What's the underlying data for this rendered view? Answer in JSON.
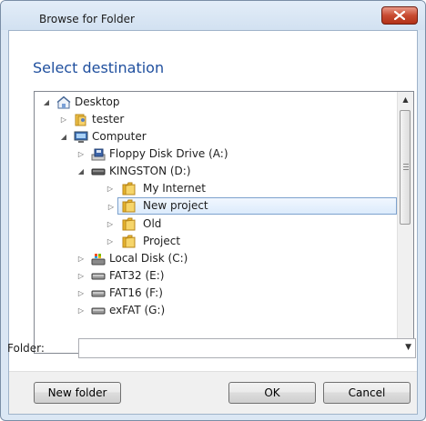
{
  "window": {
    "title": "Browse for Folder"
  },
  "heading": "Select destination",
  "tree": {
    "items": [
      {
        "label": "Desktop",
        "icon": "desktop-icon",
        "expander": "expanded"
      },
      {
        "label": "tester",
        "icon": "user-folder-icon",
        "expander": "collapsed"
      },
      {
        "label": "Computer",
        "icon": "computer-icon",
        "expander": "expanded"
      },
      {
        "label": "Floppy Disk Drive (A:)",
        "icon": "floppy-drive-icon",
        "expander": "collapsed"
      },
      {
        "label": "KINGSTON (D:)",
        "icon": "removable-drive-icon",
        "expander": "expanded"
      },
      {
        "label": "My Internet",
        "icon": "folder-icon",
        "expander": "collapsed"
      },
      {
        "label": "New project",
        "icon": "folder-icon",
        "expander": "collapsed",
        "selected": true
      },
      {
        "label": "Old",
        "icon": "folder-icon",
        "expander": "collapsed"
      },
      {
        "label": "Project",
        "icon": "folder-icon",
        "expander": "collapsed"
      },
      {
        "label": "Local Disk (C:)",
        "icon": "local-disk-icon",
        "expander": "collapsed"
      },
      {
        "label": "FAT32 (E:)",
        "icon": "drive-icon",
        "expander": "collapsed"
      },
      {
        "label": "FAT16 (F:)",
        "icon": "drive-icon",
        "expander": "collapsed"
      },
      {
        "label": "exFAT (G:)",
        "icon": "drive-icon",
        "expander": "collapsed"
      }
    ]
  },
  "folder": {
    "label": "Folder:",
    "value": ""
  },
  "buttons": {
    "new_folder": "New folder",
    "ok": "OK",
    "cancel": "Cancel"
  },
  "colors": {
    "heading": "#1f4f9e",
    "folder_yellow": "#e8b52e",
    "close_red": "#c84b31"
  }
}
